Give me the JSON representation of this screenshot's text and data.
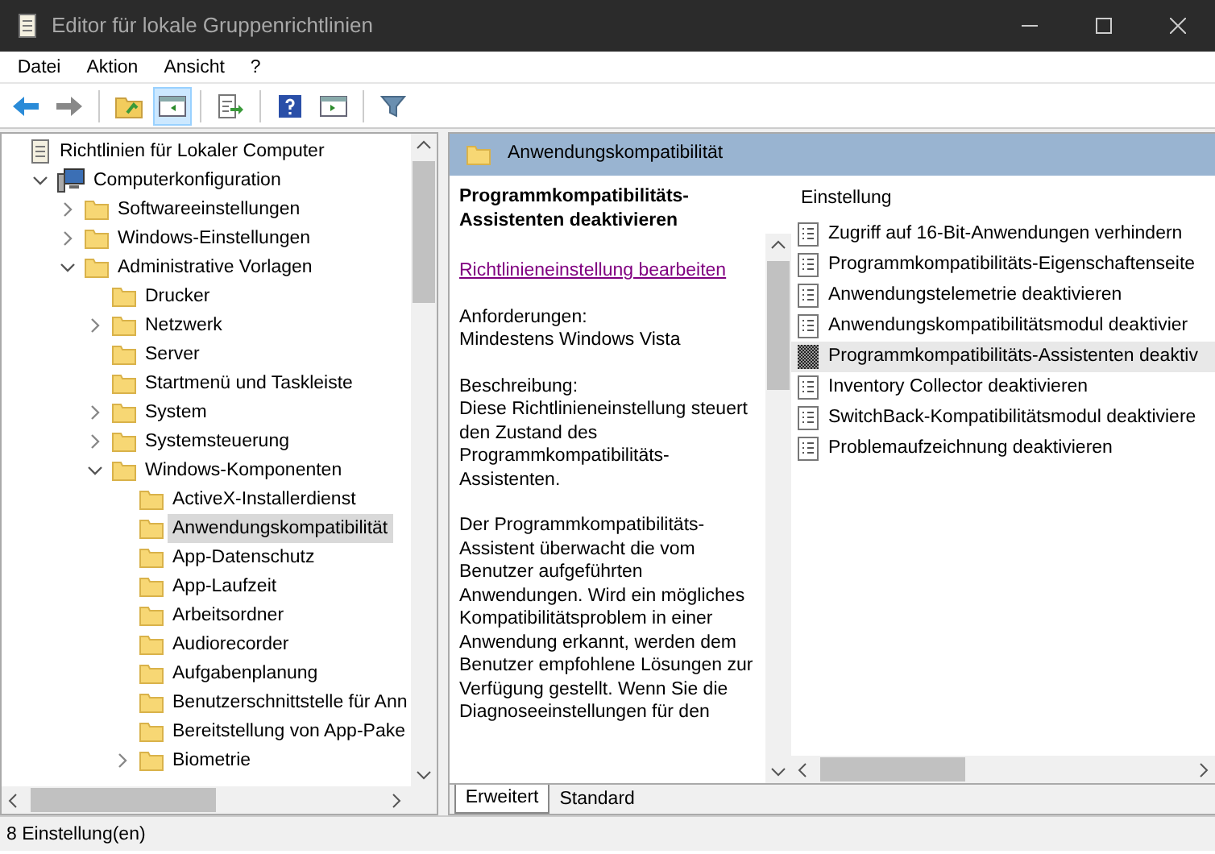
{
  "window": {
    "title": "Editor für lokale Gruppenrichtlinien"
  },
  "menu": [
    "Datei",
    "Aktion",
    "Ansicht",
    "?"
  ],
  "toolbar": [
    {
      "kind": "back",
      "selected": false
    },
    {
      "kind": "forward",
      "selected": false
    },
    {
      "kind": "sep"
    },
    {
      "kind": "up",
      "selected": false
    },
    {
      "kind": "pane",
      "selected": true
    },
    {
      "kind": "sep"
    },
    {
      "kind": "export",
      "selected": false
    },
    {
      "kind": "sep"
    },
    {
      "kind": "help",
      "selected": false
    },
    {
      "kind": "view",
      "selected": false
    },
    {
      "kind": "sep"
    },
    {
      "kind": "filter",
      "selected": false
    }
  ],
  "tree": [
    {
      "label": "Richtlinien für Lokaler Computer",
      "kind": "policy",
      "selected": false,
      "children": [
        {
          "label": "Computerkonfiguration",
          "kind": "computer",
          "expanded": true,
          "selected": false,
          "children": [
            {
              "label": "Softwareeinstellungen",
              "kind": "folder",
              "expanded": false,
              "selected": false
            },
            {
              "label": "Windows-Einstellungen",
              "kind": "folder",
              "expanded": false,
              "selected": false
            },
            {
              "label": "Administrative Vorlagen",
              "kind": "folder",
              "expanded": true,
              "selected": false,
              "children": [
                {
                  "label": "Drucker",
                  "kind": "folder",
                  "selected": false
                },
                {
                  "label": "Netzwerk",
                  "kind": "folder",
                  "expanded": false,
                  "selected": false
                },
                {
                  "label": "Server",
                  "kind": "folder",
                  "selected": false
                },
                {
                  "label": "Startmenü und Taskleiste",
                  "kind": "folder",
                  "selected": false
                },
                {
                  "label": "System",
                  "kind": "folder",
                  "expanded": false,
                  "selected": false
                },
                {
                  "label": "Systemsteuerung",
                  "kind": "folder",
                  "expanded": false,
                  "selected": false
                },
                {
                  "label": "Windows-Komponenten",
                  "kind": "folder",
                  "expanded": true,
                  "selected": false,
                  "children": [
                    {
                      "label": "ActiveX-Installerdienst",
                      "kind": "folder",
                      "selected": false
                    },
                    {
                      "label": "Anwendungskompatibilität",
                      "kind": "folder",
                      "selected": true
                    },
                    {
                      "label": "App-Datenschutz",
                      "kind": "folder",
                      "selected": false
                    },
                    {
                      "label": "App-Laufzeit",
                      "kind": "folder",
                      "selected": false
                    },
                    {
                      "label": "Arbeitsordner",
                      "kind": "folder",
                      "selected": false
                    },
                    {
                      "label": "Audiorecorder",
                      "kind": "folder",
                      "selected": false
                    },
                    {
                      "label": "Aufgabenplanung",
                      "kind": "folder",
                      "selected": false
                    },
                    {
                      "label": "Benutzerschnittstelle für Ann",
                      "kind": "folder",
                      "selected": false
                    },
                    {
                      "label": "Bereitstellung von App-Pake",
                      "kind": "folder",
                      "selected": false
                    },
                    {
                      "label": "Biometrie",
                      "kind": "folder",
                      "expanded": false,
                      "selected": false
                    }
                  ]
                }
              ]
            }
          ]
        }
      ]
    }
  ],
  "details": {
    "header": "Anwendungskompatibilität",
    "title": "Programmkompatibilitäts-Assistenten deaktivieren",
    "link": "Richtlinieneinstellung bearbeiten",
    "paragraphs": [
      "Anforderungen:\nMindestens Windows Vista",
      "Beschreibung:\nDiese Richtlinieneinstellung steuert den Zustand des Programmkompatibilitäts-Assistenten.",
      "Der Programmkompatibilitäts-Assistent überwacht die vom Benutzer aufgeführten Anwendungen. Wird ein mögliches Kompatibilitätsproblem in einer Anwendung erkannt, werden dem Benutzer empfohlene Lösungen zur Verfügung gestellt.  Wenn Sie die Diagnoseeinstellungen für den"
    ]
  },
  "settings": {
    "column": "Einstellung",
    "rows": [
      {
        "label": "Zugriff auf 16-Bit-Anwendungen verhindern",
        "selected": false
      },
      {
        "label": "Programmkompatibilitäts-Eigenschaftenseite",
        "selected": false
      },
      {
        "label": "Anwendungstelemetrie deaktivieren",
        "selected": false
      },
      {
        "label": "Anwendungskompatibilitätsmodul deaktivier",
        "selected": false
      },
      {
        "label": "Programmkompatibilitäts-Assistenten deaktiv",
        "selected": true
      },
      {
        "label": "Inventory Collector deaktivieren",
        "selected": false
      },
      {
        "label": "SwitchBack-Kompatibilitätsmodul deaktiviere",
        "selected": false
      },
      {
        "label": "Problemaufzeichnung deaktivieren",
        "selected": false
      }
    ]
  },
  "view_tabs": [
    {
      "label": "Erweitert",
      "selected": true
    },
    {
      "label": "Standard",
      "selected": false
    }
  ],
  "status_bar": "8 Einstellung(en)"
}
